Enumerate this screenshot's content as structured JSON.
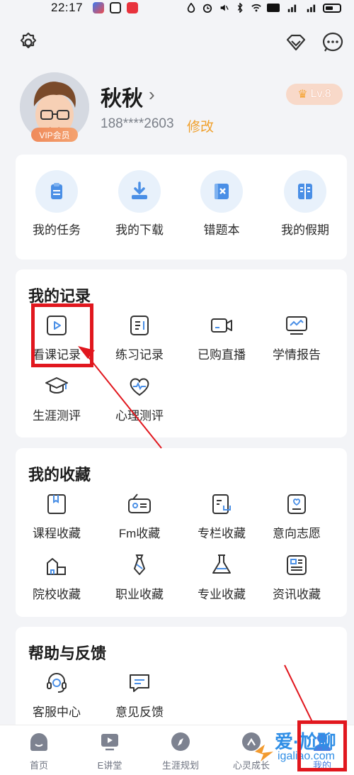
{
  "status_bar": {
    "time": "22:17"
  },
  "profile": {
    "name": "秋秋",
    "phone": "188****2603",
    "edit_label": "修改",
    "vip_label": "VIP会员",
    "level": "Lv.8"
  },
  "quick": [
    {
      "label": "我的任务",
      "icon": "clipboard-icon"
    },
    {
      "label": "我的下载",
      "icon": "download-icon"
    },
    {
      "label": "错题本",
      "icon": "error-book-icon"
    },
    {
      "label": "我的假期",
      "icon": "holiday-book-icon"
    }
  ],
  "records": {
    "title": "我的记录",
    "items": [
      {
        "label": "看课记录",
        "icon": "play-video-icon"
      },
      {
        "label": "练习记录",
        "icon": "practice-icon"
      },
      {
        "label": "已购直播",
        "icon": "camera-icon"
      },
      {
        "label": "学情报告",
        "icon": "monitor-chart-icon"
      },
      {
        "label": "生涯测评",
        "icon": "grad-cap-icon"
      },
      {
        "label": "心理测评",
        "icon": "heart-pulse-icon"
      }
    ]
  },
  "favorites": {
    "title": "我的收藏",
    "items": [
      {
        "label": "课程收藏",
        "icon": "bookmark-book-icon"
      },
      {
        "label": "Fm收藏",
        "icon": "radio-icon"
      },
      {
        "label": "专栏收藏",
        "icon": "column-doc-icon"
      },
      {
        "label": "意向志愿",
        "icon": "heart-doc-icon"
      },
      {
        "label": "院校收藏",
        "icon": "school-icon"
      },
      {
        "label": "职业收藏",
        "icon": "tie-icon"
      },
      {
        "label": "专业收藏",
        "icon": "flask-icon"
      },
      {
        "label": "资讯收藏",
        "icon": "news-icon"
      }
    ]
  },
  "help": {
    "title": "帮助与反馈",
    "items": [
      {
        "label": "客服中心",
        "icon": "headset-icon"
      },
      {
        "label": "意见反馈",
        "icon": "chat-feedback-icon"
      }
    ]
  },
  "nav": [
    {
      "label": "首页",
      "icon": "home-icon"
    },
    {
      "label": "E讲堂",
      "icon": "video-play-icon"
    },
    {
      "label": "生涯规划",
      "icon": "compass-icon"
    },
    {
      "label": "心灵成长",
      "icon": "growth-icon"
    },
    {
      "label": "我的",
      "icon": "profile-icon"
    }
  ],
  "watermark": {
    "text": "爱·尬聊",
    "sub": "igaliao.com"
  },
  "colors": {
    "accent_blue": "#4a8fe6",
    "annotation_red": "#e1171e",
    "edit_orange": "#f0a02c"
  }
}
